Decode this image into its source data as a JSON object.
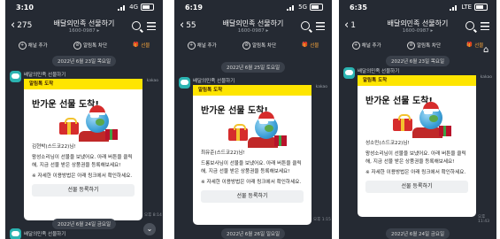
{
  "common": {
    "title": "배달의민족 선물하기",
    "subtitle": "1600-0987 ▸",
    "action_add": "채널 추가",
    "action_block": "알림톡 차단",
    "action_gift": "선물",
    "sender_name": "배달의민족 선물하기",
    "kakao_tag": "kakao",
    "notice_header": "알림톡 도착",
    "gift_title": "반가운 선물 도착!",
    "msg_line2": "왕성소리님이 선물을 보냈어요. 아래 버튼을 클릭해, 지금 선물 받은 상품권을 등록해보세요!",
    "msg_line3": "※ 자세한 이용방법은 아래 링크에서 확인하세요.",
    "register_button": "선물 등록하기",
    "icons": {
      "search": "search-icon",
      "menu": "menu-icon",
      "gift": "gift-icon",
      "home": "home-icon"
    }
  },
  "phones": [
    {
      "time": "3:10",
      "network": "4G",
      "back_count": "275",
      "date_top": "2022년 6월 23일 목요일",
      "recipient": "김현박(스드코22)님!",
      "msg_line2": "왕성소리님이 선물을 보냈어요. 아래 버튼을 클릭해, 지금 선물 받은 상품권을 등록해보세요!",
      "stamp": "오후 8:14",
      "date_bottom": "2022년 6월 24일 금요일"
    },
    {
      "time": "6:19",
      "network": "5G",
      "back_count": "55",
      "date_top": "2022년 6월 25일 토요일",
      "recipient": "최유준(스드코22)님!",
      "msg_line2": "드롱보사님이 선물을 보냈어요. 아래 버튼을 클릭해, 지금 선물 받은 상품권을 등록해보세요!",
      "stamp": "오후 1:15",
      "date_bottom": "2022년 6월 26일 일요일"
    },
    {
      "time": "6:35",
      "network": "LTE",
      "back_count": "1",
      "date_top": "2022년 6월 23일 목요일",
      "recipient": "성소민(스드코22)님!",
      "msg_line2": "왕성소리님이 선물을 보냈어요. 아래 버튼을 클릭해, 지금 선물 받은 상품권을 등록해보세요!",
      "stamp": "오후 11:43",
      "date_bottom": "2022년 6월 24일 금요일"
    }
  ]
}
